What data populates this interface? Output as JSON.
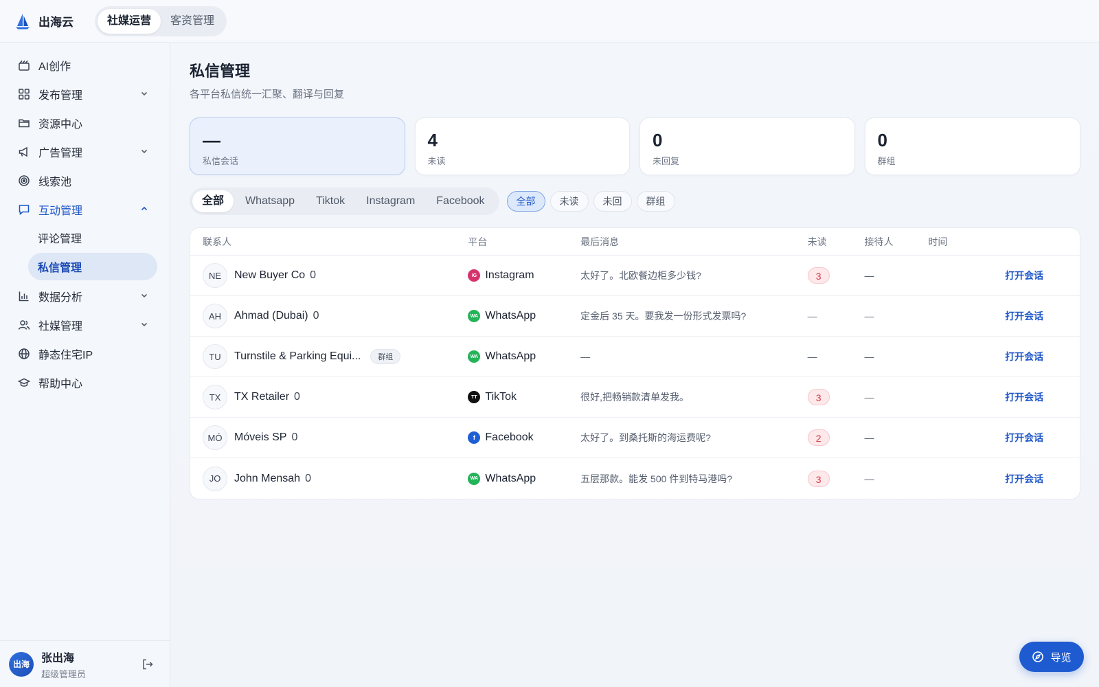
{
  "brand": {
    "name": "出海云"
  },
  "top_tabs": [
    {
      "label": "社媒运营",
      "active": true
    },
    {
      "label": "客资管理",
      "active": false
    }
  ],
  "sidebar": {
    "items": [
      {
        "label": "AI创作",
        "icon": "ai-create-icon"
      },
      {
        "label": "发布管理",
        "icon": "grid-icon",
        "expandable": true
      },
      {
        "label": "资源中心",
        "icon": "folder-icon"
      },
      {
        "label": "广告管理",
        "icon": "megaphone-icon",
        "expandable": true
      },
      {
        "label": "线索池",
        "icon": "target-icon"
      },
      {
        "label": "互动管理",
        "icon": "chat-icon",
        "expandable": true,
        "open": true
      },
      {
        "label": "数据分析",
        "icon": "bar-chart-icon",
        "expandable": true
      },
      {
        "label": "社媒管理",
        "icon": "users-icon",
        "expandable": true
      },
      {
        "label": "静态住宅IP",
        "icon": "globe-icon"
      },
      {
        "label": "帮助中心",
        "icon": "graduation-cap-icon"
      }
    ],
    "sub_items": [
      {
        "label": "评论管理",
        "active": false
      },
      {
        "label": "私信管理",
        "active": true
      }
    ]
  },
  "user": {
    "avatar_text": "出海",
    "name": "张出海",
    "role": "超级管理员"
  },
  "page": {
    "title": "私信管理",
    "subtitle": "各平台私信统一汇聚、翻译与回复"
  },
  "stats": [
    {
      "value": "—",
      "label": "私信会话",
      "active": true
    },
    {
      "value": "4",
      "label": "未读"
    },
    {
      "value": "0",
      "label": "未回复"
    },
    {
      "value": "0",
      "label": "群组"
    }
  ],
  "platform_tabs": [
    {
      "label": "全部",
      "active": true
    },
    {
      "label": "Whatsapp"
    },
    {
      "label": "Tiktok"
    },
    {
      "label": "Instagram"
    },
    {
      "label": "Facebook"
    }
  ],
  "status_chips": [
    {
      "label": "全部",
      "active": true
    },
    {
      "label": "未读"
    },
    {
      "label": "未回"
    },
    {
      "label": "群组"
    }
  ],
  "table": {
    "headers": {
      "contact": "联系人",
      "platform": "平台",
      "last_message": "最后消息",
      "unread": "未读",
      "agent": "接待人",
      "time": "时间"
    },
    "rows": [
      {
        "initials": "NE",
        "name": "New Buyer Co",
        "count": "0",
        "platform": "Instagram",
        "platform_badge": "IG",
        "platform_color": "#d6336c",
        "message": "太好了。北欧餐边柜多少钱?",
        "unread": "3",
        "agent": "—",
        "time": "",
        "action": "打开会话"
      },
      {
        "initials": "AH",
        "name": "Ahmad (Dubai)",
        "count": "0",
        "platform": "WhatsApp",
        "platform_badge": "WA",
        "platform_color": "#25b35a",
        "message": "定金后 35 天。要我发一份形式发票吗?",
        "unread": "—",
        "agent": "—",
        "time": "",
        "action": "打开会话"
      },
      {
        "initials": "TU",
        "name": "Turnstile & Parking Equi...",
        "count": "",
        "group_badge": "群组",
        "platform": "WhatsApp",
        "platform_badge": "WA",
        "platform_color": "#25b35a",
        "message": "—",
        "unread": "—",
        "agent": "—",
        "time": "",
        "action": "打开会话"
      },
      {
        "initials": "TX",
        "name": "TX Retailer",
        "count": "0",
        "platform": "TikTok",
        "platform_badge": "TT",
        "platform_color": "#111111",
        "message": "很好,把畅销款清单发我。",
        "unread": "3",
        "agent": "—",
        "time": "",
        "action": "打开会话"
      },
      {
        "initials": "MÓ",
        "name": "Móveis SP",
        "count": "0",
        "platform": "Facebook",
        "platform_badge": "f",
        "platform_color": "#1f5fd6",
        "message": "太好了。到桑托斯的海运费呢?",
        "unread": "2",
        "agent": "—",
        "time": "",
        "action": "打开会话"
      },
      {
        "initials": "JO",
        "name": "John Mensah",
        "count": "0",
        "platform": "WhatsApp",
        "platform_badge": "WA",
        "platform_color": "#25b35a",
        "message": "五层那款。能发 500 件到特马港吗?",
        "unread": "3",
        "agent": "—",
        "time": "",
        "action": "打开会话"
      }
    ]
  },
  "guide_button": {
    "label": "导览"
  }
}
